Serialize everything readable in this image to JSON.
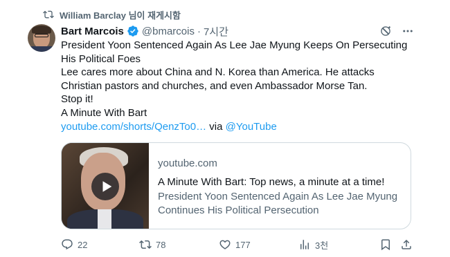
{
  "repost": {
    "icon": "repost-icon",
    "text": "William Barclay 님이 재게시함"
  },
  "author": {
    "display_name": "Bart Marcois",
    "handle": "@bmarcois",
    "separator": "·",
    "time": "7시간",
    "verified_color": "#1d9bf0"
  },
  "tweet": {
    "lines": [
      "President Yoon Sentenced Again As Lee Jae Myung Keeps On Persecuting",
      "His Political Foes",
      "Lee cares more about China and N. Korea than America. He attacks",
      "Christian pastors and churches, and even Ambassador Morse Tan.",
      "Stop it!",
      "A Minute With Bart"
    ],
    "link_text": "youtube.com/shorts/QenzTo0…",
    "via": "via",
    "mention": "@YouTube"
  },
  "card": {
    "domain": "youtube.com",
    "title": "A Minute With Bart: Top news, a minute at a time!",
    "description_lines": [
      "President Yoon Sentenced Again As Lee Jae Myung",
      "Continues His Political Persecution"
    ]
  },
  "actions": {
    "replies": "22",
    "reposts": "78",
    "likes": "177",
    "views": "3천"
  },
  "colors": {
    "accent": "#1d9bf0",
    "secondary_text": "#536471",
    "primary_text": "#0f1419",
    "border": "#cfd9de"
  }
}
